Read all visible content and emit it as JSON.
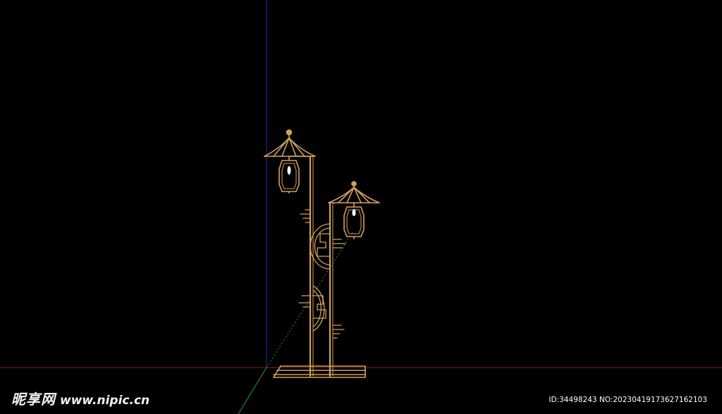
{
  "colors": {
    "background": "#000000",
    "lamp": "#d4a05c",
    "lamp_highlight": "#e8b878",
    "axis_red": "#8b1a1a",
    "axis_green": "#2e8b2e",
    "axis_blue": "#1a1a8b",
    "bulb": "#ffffff"
  },
  "watermark": {
    "logo_cn": "昵享网",
    "logo_url": "www.nipic.cn",
    "id_line": "ID:34498243 NO:20230419173627162103"
  },
  "icons": {
    "model": "street-lamp-model-icon",
    "axes": "3d-axes-icon"
  }
}
